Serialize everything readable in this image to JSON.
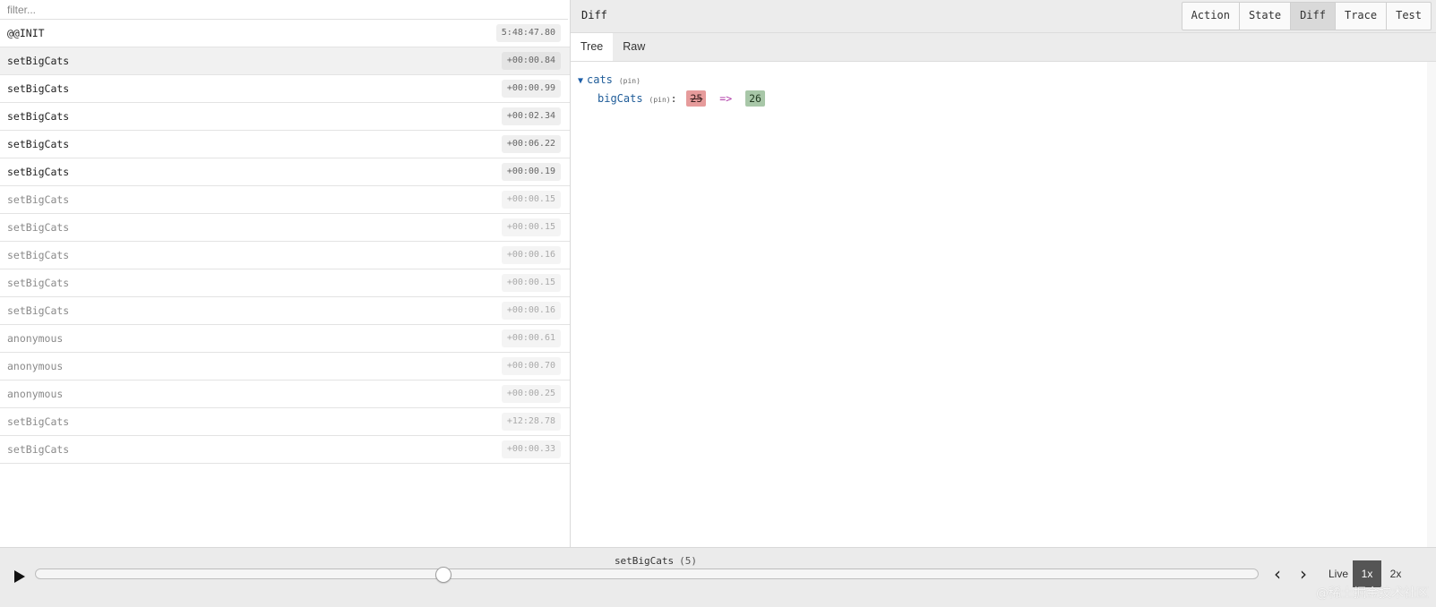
{
  "filter": {
    "placeholder": "filter..."
  },
  "actions": [
    {
      "name": "@@INIT",
      "time": "5:48:47.80"
    },
    {
      "name": "setBigCats",
      "time": "+00:00.84"
    },
    {
      "name": "setBigCats",
      "time": "+00:00.99"
    },
    {
      "name": "setBigCats",
      "time": "+00:02.34"
    },
    {
      "name": "setBigCats",
      "time": "+00:06.22"
    },
    {
      "name": "setBigCats",
      "time": "+00:00.19"
    },
    {
      "name": "setBigCats",
      "time": "+00:00.15"
    },
    {
      "name": "setBigCats",
      "time": "+00:00.15"
    },
    {
      "name": "setBigCats",
      "time": "+00:00.16"
    },
    {
      "name": "setBigCats",
      "time": "+00:00.15"
    },
    {
      "name": "setBigCats",
      "time": "+00:00.16"
    },
    {
      "name": "anonymous",
      "time": "+00:00.61"
    },
    {
      "name": "anonymous",
      "time": "+00:00.70"
    },
    {
      "name": "anonymous",
      "time": "+00:00.25"
    },
    {
      "name": "setBigCats",
      "time": "+12:28.78"
    },
    {
      "name": "setBigCats",
      "time": "+00:00.33"
    }
  ],
  "monitor": {
    "title": "Diff",
    "tabs": [
      "Action",
      "State",
      "Diff",
      "Trace",
      "Test"
    ],
    "active_tab": "Diff",
    "sub_tabs": [
      "Tree",
      "Raw"
    ],
    "active_sub_tab": "Tree"
  },
  "diff": {
    "root_key": "cats",
    "pin_label": "(pin)",
    "child_key": "bigCats",
    "colon": ":",
    "old_value": "25",
    "arrow": "=>",
    "new_value": "26"
  },
  "slider": {
    "label": "setBigCats",
    "count": "(5)",
    "position_fraction": 0.333,
    "prev_icon": "chevron-left-icon",
    "next_icon": "chevron-right-icon",
    "play_icon": "play-icon",
    "speeds": [
      "Live",
      "1x",
      "2x"
    ],
    "active_speed": "1x"
  },
  "watermark": "@稀土掘金技术社区",
  "colors": {
    "selected_row": "#f1f1f1",
    "old_value_bg": "#e69b9b",
    "new_value_bg": "#a8c7a8",
    "key_color": "#205d99",
    "arrow_op": "#b03ca8",
    "active_speed_bg": "#555555"
  }
}
